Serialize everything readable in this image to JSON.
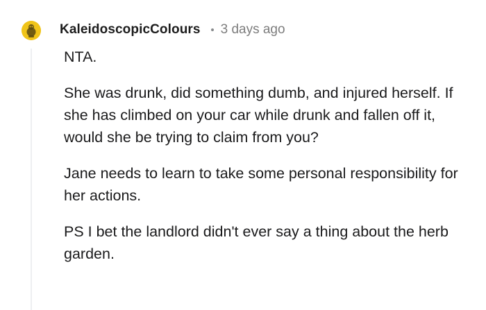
{
  "comment": {
    "author": "KaleidoscopicColours",
    "separator": "•",
    "timestamp": "3 days ago",
    "paragraphs": [
      "NTA.",
      "She was drunk, did something dumb, and injured herself. If she has climbed on your car while drunk and fallen off it, would she be trying to claim from you?",
      "Jane needs to learn to take some personal responsibility for her actions.",
      "PS I bet the landlord didn't ever say a thing about the herb garden."
    ]
  },
  "colors": {
    "avatar_background": "#f0c419",
    "thread_line": "#edeff1",
    "meta_text": "#7c7c7c"
  },
  "icons": {
    "avatar": "snoo-avatar-icon"
  }
}
